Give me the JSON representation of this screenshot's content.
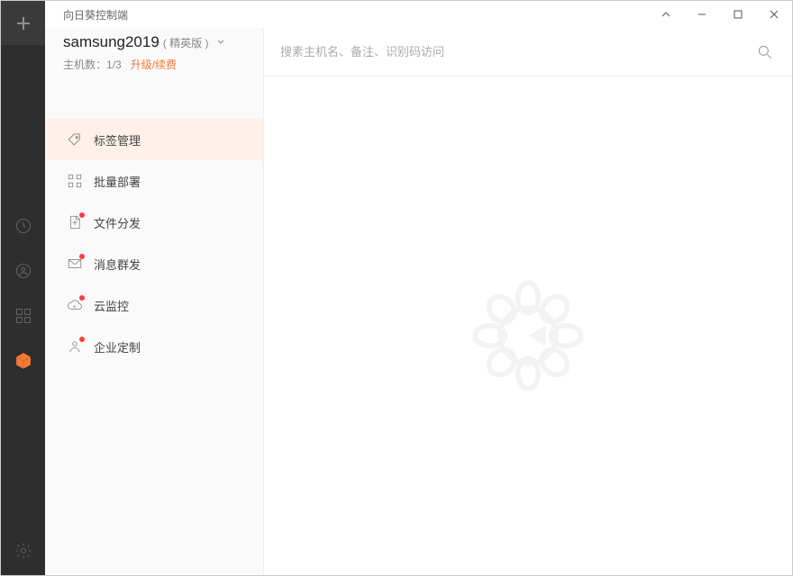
{
  "app_title": "向日葵控制端",
  "account": {
    "name": "samsung2019",
    "plan": "( 精英版 )",
    "hosts_label": "主机数：",
    "hosts_count": "1/3",
    "upgrade_label": "升级/续费"
  },
  "menu": [
    {
      "id": "tags",
      "label": "标签管理",
      "active": true,
      "dot": false
    },
    {
      "id": "deploy",
      "label": "批量部署",
      "active": false,
      "dot": false
    },
    {
      "id": "files",
      "label": "文件分发",
      "active": false,
      "dot": true
    },
    {
      "id": "msg",
      "label": "消息群发",
      "active": false,
      "dot": true
    },
    {
      "id": "monitor",
      "label": "云监控",
      "active": false,
      "dot": true
    },
    {
      "id": "custom",
      "label": "企业定制",
      "active": false,
      "dot": true
    }
  ],
  "search": {
    "placeholder": "搜素主机名、备注、识别码访问"
  }
}
